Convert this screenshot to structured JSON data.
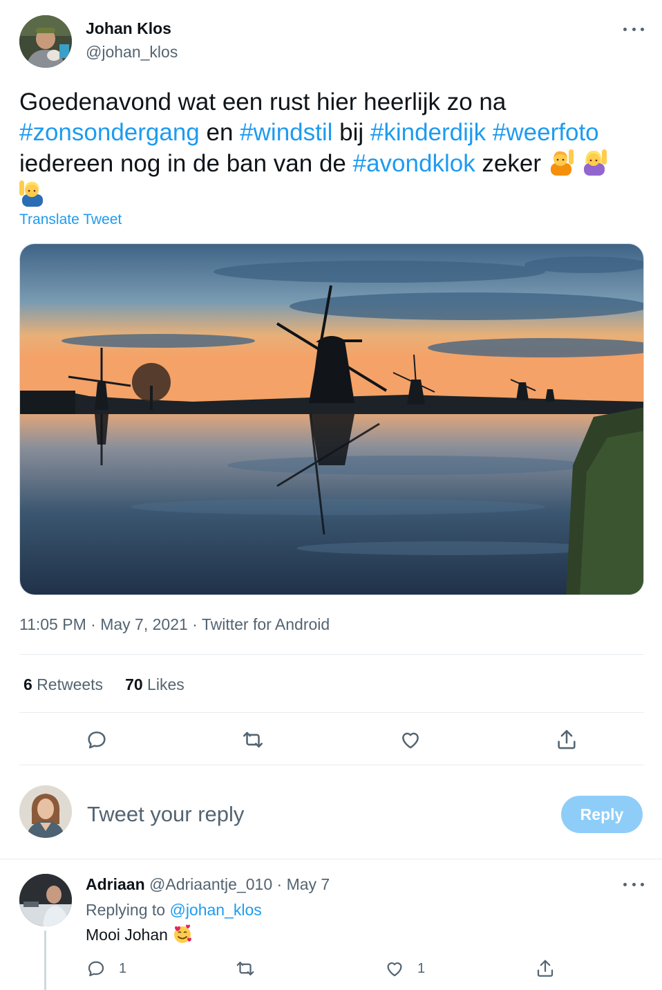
{
  "tweet": {
    "author_name": "Johan Klos",
    "author_handle": "@johan_klos",
    "text_1": "Goedenavond wat een rust hier heerlijk zo na ",
    "hashtag_1": "#zonsondergang",
    "text_2": " en ",
    "hashtag_2": "#windstil",
    "text_3": " bij ",
    "hashtag_3": "#kinderdijk",
    "text_4": " ",
    "hashtag_4": "#weerfoto",
    "text_5": " iedereen nog in de ban van de ",
    "hashtag_5": "#avondklok",
    "text_6": " zeker ",
    "emojis": [
      "person-raising-hand-icon",
      "woman-raising-hand-icon",
      "man-raising-hand-icon"
    ],
    "translate_label": "Translate Tweet",
    "time": "11:05 PM",
    "sep": " · ",
    "date": "May 7, 2021",
    "source": "Twitter for Android",
    "photo_subject": "windmill-sunset-photo"
  },
  "stats": {
    "retweets_count": "6",
    "retweets_label": " Retweets",
    "likes_count": "70",
    "likes_label": " Likes"
  },
  "composer": {
    "placeholder": "Tweet your reply",
    "reply_label": "Reply"
  },
  "reply": {
    "name": "Adriaan",
    "handle": " @Adriaantje_010",
    "sep": " · ",
    "date": "May 7",
    "replying_label": "Replying to ",
    "replying_to": "@johan_klos",
    "text": "Mooi Johan",
    "emoji": "smiling-face-with-hearts-icon",
    "reply_count": "1",
    "like_count": "1"
  },
  "colors": {
    "link": "#1d9bf0",
    "text": "#0f1419",
    "muted": "#536471",
    "reply_button": "#8ecdf8",
    "divider": "#e6ecf0"
  }
}
